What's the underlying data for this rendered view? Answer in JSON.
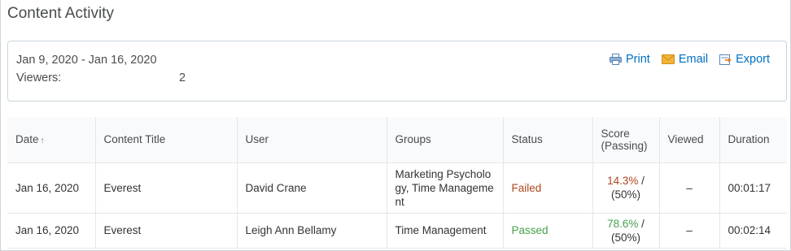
{
  "page": {
    "title": "Content Activity"
  },
  "summary": {
    "date_range": "Jan 9, 2020 - Jan 16, 2020",
    "viewers_label": "Viewers:",
    "viewers_count": "2"
  },
  "actions": {
    "print": "Print",
    "email": "Email",
    "export": "Export"
  },
  "colors": {
    "link": "#006fbf",
    "failed": "#b0461f",
    "passed": "#46a04a",
    "print_icon": "printer-icon",
    "email_icon": "envelope-icon",
    "export_icon": "export-icon"
  },
  "table": {
    "columns": {
      "date": "Date",
      "date_sort_icon": "↑",
      "content_title": "Content Title",
      "user": "User",
      "groups": "Groups",
      "status": "Status",
      "score": "Score",
      "score_sub": "(Passing)",
      "viewed": "Viewed",
      "duration": "Duration"
    },
    "rows": [
      {
        "date": "Jan 16, 2020",
        "content_title": "Everest",
        "user": "David Crane",
        "groups_line1": "Marketing Psycholo",
        "groups_line2": "gy, Time Manageme",
        "groups_line3": "nt",
        "status": "Failed",
        "score": "14.3%",
        "score_sep": " /",
        "passing": "(50%)",
        "viewed": "–",
        "duration": "00:01:17"
      },
      {
        "date": "Jan 16, 2020",
        "content_title": "Everest",
        "user": "Leigh Ann Bellamy",
        "groups_line1": "Time Management",
        "status": "Passed",
        "score": "78.6%",
        "score_sep": " /",
        "passing": "(50%)",
        "viewed": "–",
        "duration": "00:02:14"
      }
    ]
  }
}
